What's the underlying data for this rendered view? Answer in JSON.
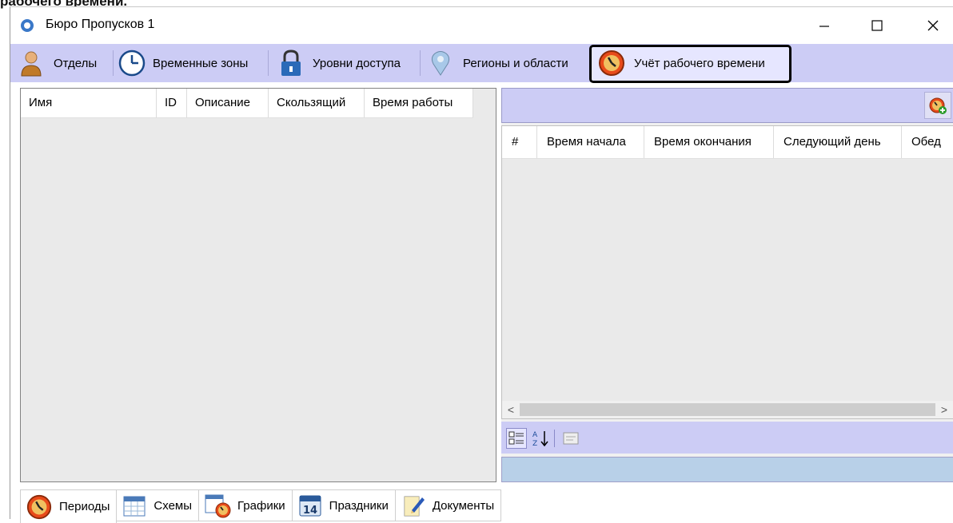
{
  "caption": "рабочего времени.",
  "window": {
    "title": "Бюро Пропусков 1",
    "controls": {
      "minimize": "—",
      "maximize": "☐",
      "close": "✕"
    }
  },
  "toolbar": {
    "items": [
      {
        "label": "Отделы",
        "icon": "person-icon"
      },
      {
        "label": "Временные зоны",
        "icon": "clock-icon"
      },
      {
        "label": "Уровни доступа",
        "icon": "lock-icon"
      },
      {
        "label": "Регионы и области",
        "icon": "map-pin-icon"
      },
      {
        "label": "Учёт рабочего времени",
        "icon": "timesheet-clock-icon",
        "selected": true
      }
    ]
  },
  "left_grid": {
    "columns": [
      "Имя",
      "ID",
      "Описание",
      "Скользящий",
      "Время работы"
    ]
  },
  "right_grid": {
    "columns": [
      "#",
      "Время начала",
      "Время окончания",
      "Следующий день",
      "Обед"
    ]
  },
  "scrollbar": {
    "left": "<",
    "right": ">"
  },
  "bottom_tabs": [
    {
      "label": "Периоды",
      "icon": "timesheet-clock-icon",
      "active": true
    },
    {
      "label": "Схемы",
      "icon": "calendar-grid-icon"
    },
    {
      "label": "Графики",
      "icon": "calendar-clock-icon"
    },
    {
      "label": "Праздники",
      "icon": "calendar-14-icon"
    },
    {
      "label": "Документы",
      "icon": "document-pen-icon"
    }
  ],
  "colors": {
    "toolbar_bg": "#ccccf5",
    "grid_bg": "#eaeaea",
    "description_bar": "#b8d0e8"
  }
}
